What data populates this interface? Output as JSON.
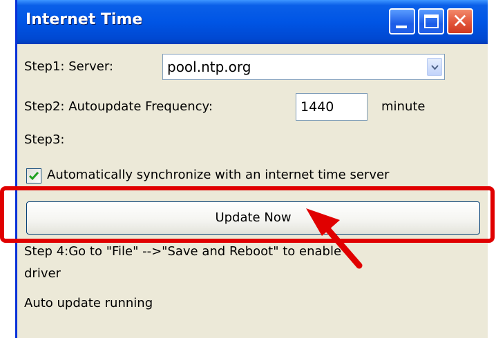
{
  "window": {
    "title": "Internet Time",
    "controls": {
      "minimize_icon": "minimize-icon",
      "maximize_icon": "maximize-icon",
      "close_icon": "close-icon"
    }
  },
  "form": {
    "step1_label": "Step1: Server:",
    "server_value": "pool.ntp.org",
    "step2_label": "Step2: Autoupdate Frequency:",
    "frequency_value": "1440",
    "frequency_unit": "minute",
    "step3_label": "Step3:",
    "auto_sync_checked": true,
    "auto_sync_label": "Automatically synchronize with an internet time server",
    "update_button": "Update Now",
    "step4_line1": "Step 4:Go to \"File\" -->\"Save and Reboot\" to enable",
    "step4_line2": "driver",
    "status": "Auto update running"
  },
  "colors": {
    "titlebar": "#0055e5",
    "window_bg": "#ece9d8",
    "annotation": "#e00000"
  }
}
